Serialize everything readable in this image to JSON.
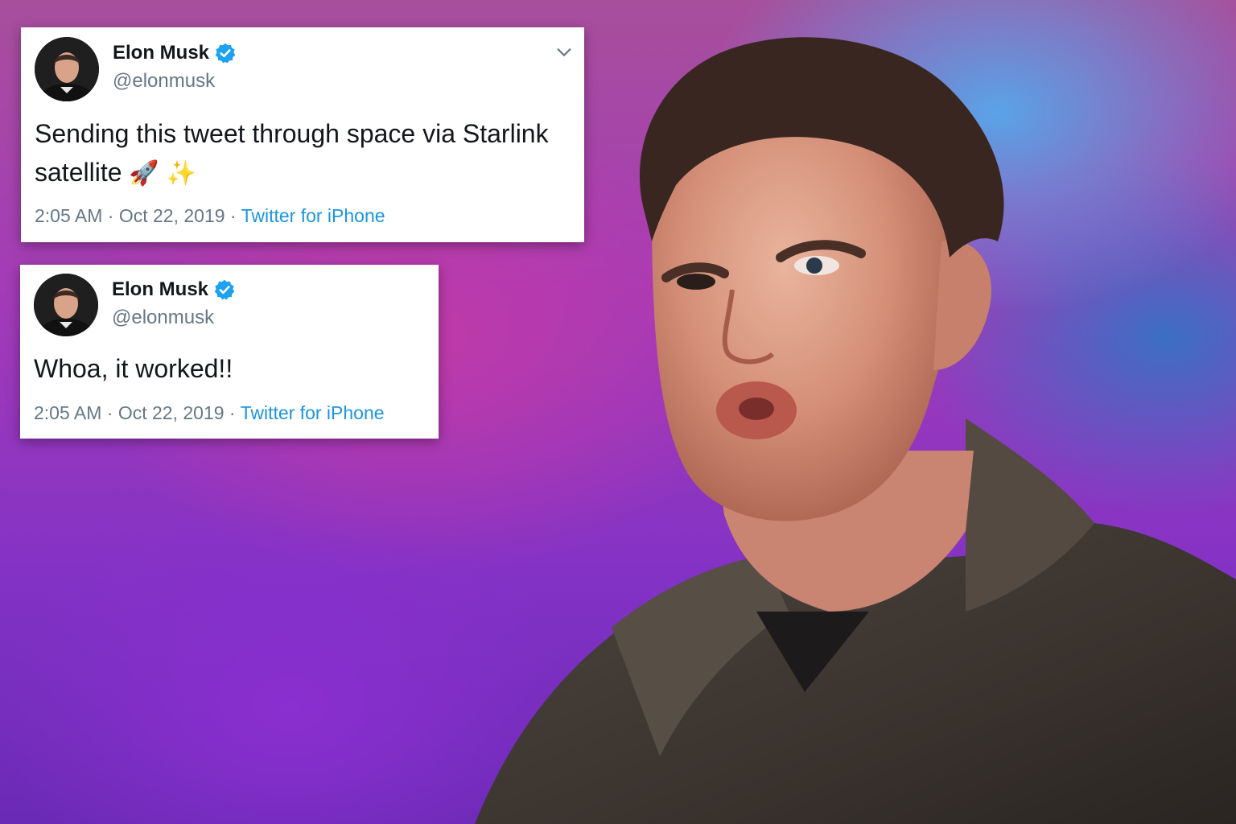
{
  "tweets": [
    {
      "display_name": "Elon Musk",
      "handle": "@elonmusk",
      "text": "Sending this tweet through space via Starlink satellite",
      "emojis": [
        "🚀",
        "✨"
      ],
      "time": "2:05 AM",
      "date": "Oct 22, 2019",
      "separator": " · ",
      "source": "Twitter for iPhone",
      "verified_icon": "verified-badge-icon",
      "menu_icon": "chevron-down-icon"
    },
    {
      "display_name": "Elon Musk",
      "handle": "@elonmusk",
      "text": "Whoa, it worked!!",
      "time": "2:05 AM",
      "date": "Oct 22, 2019",
      "separator": " · ",
      "source": "Twitter for iPhone",
      "verified_icon": "verified-badge-icon"
    }
  ],
  "colors": {
    "verified_blue": "#1da1f2",
    "link_blue": "#1b95e0",
    "muted_gray": "#657786",
    "text_black": "#14171a"
  }
}
